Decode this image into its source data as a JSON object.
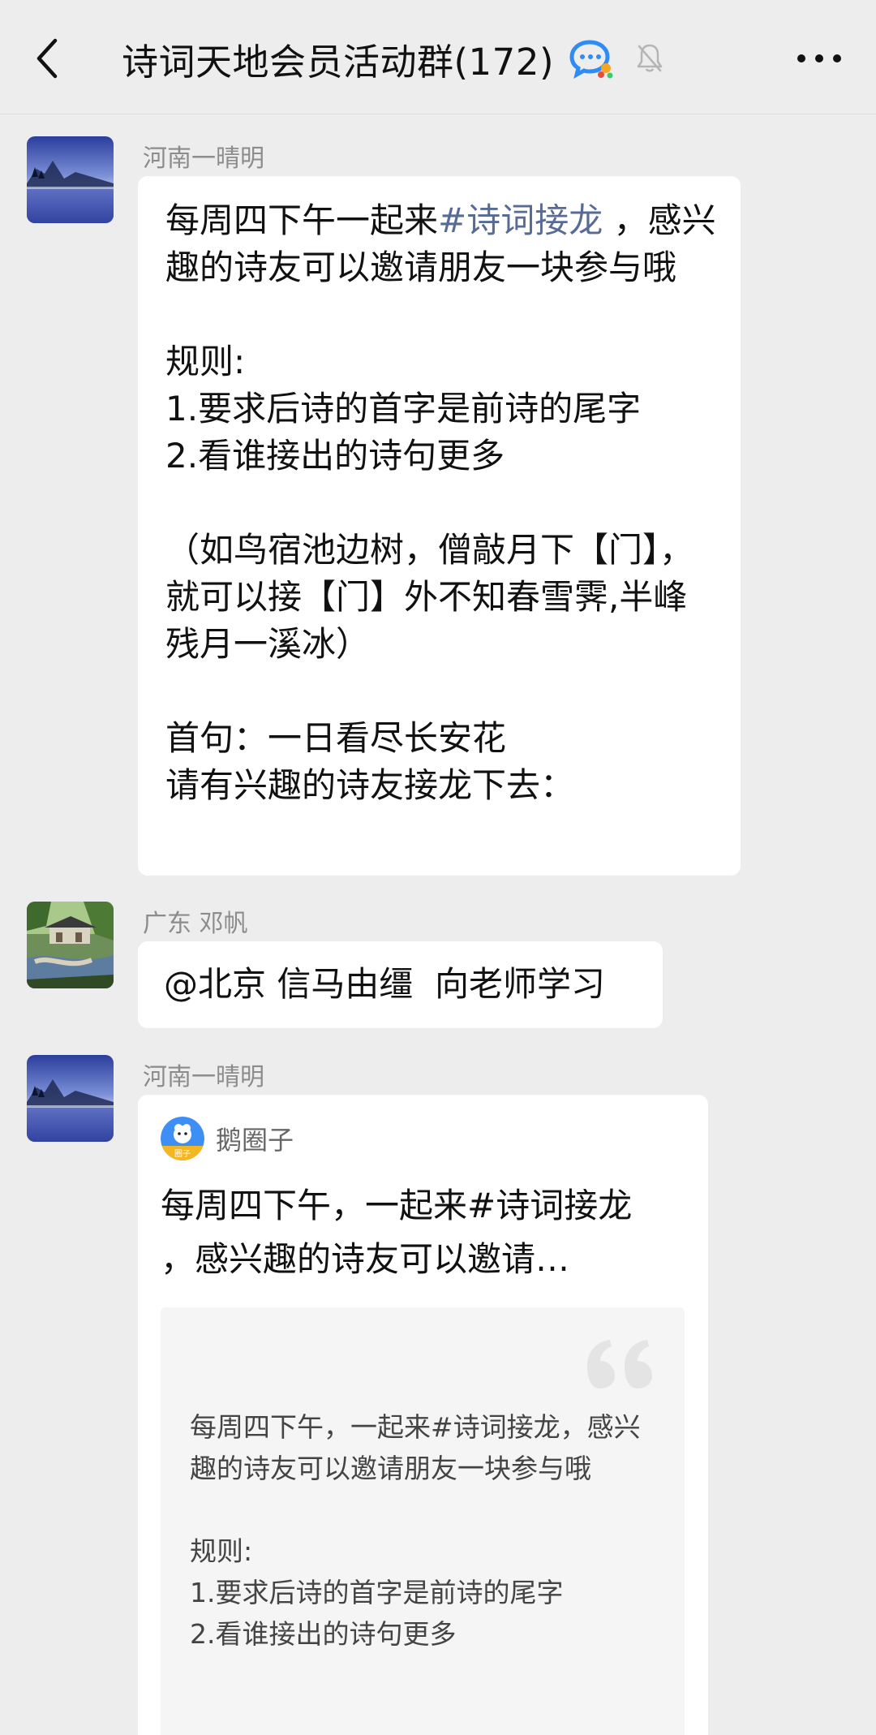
{
  "header": {
    "title": "诗词天地会员活动群(172)",
    "back_icon": "chevron-left-icon",
    "community_icon": "chat-bubble-icon",
    "mute_icon": "bell-off-icon",
    "more_icon": "more-dots-icon"
  },
  "messages": [
    {
      "sender": "河南一晴明",
      "avatar": "lake-landscape-avatar",
      "text_before_tag": "每周四下午一起来",
      "hashtag": "#诗词接龙",
      "text_after_tag": " ，感兴趣的诗友可以邀请朋友一块参与哦\n\n规则:\n1.要求后诗的首字是前诗的尾字\n2.看谁接出的诗句更多\n\n（如鸟宿池边树，僧敲月下【门】，就可以接【门】外不知春雪霁,半峰残月一溪冰）\n\n首句：一日看尽长安花\n请有兴趣的诗友接龙下去："
    },
    {
      "sender": "广东 邓帆",
      "avatar": "garden-landscape-avatar",
      "text": "@北京 信马由缰  向老师学习"
    },
    {
      "sender": "河南一晴明",
      "avatar": "lake-landscape-avatar",
      "card": {
        "source_name": "鹅圈子",
        "source_logo_label": "圈子",
        "title": "每周四下午，一起来#诗词接龙 ，感兴趣的诗友可以邀请…",
        "preview": "每周四下午，一起来#诗词接龙，感兴趣的诗友可以邀请朋友一块参与哦\n\n规则:\n1.要求后诗的首字是前诗的尾字\n2.看谁接出的诗句更多"
      }
    }
  ],
  "colors": {
    "background": "#ededed",
    "bubble": "#ffffff",
    "hashtag": "#576b95",
    "sender": "#8c8c8c"
  }
}
